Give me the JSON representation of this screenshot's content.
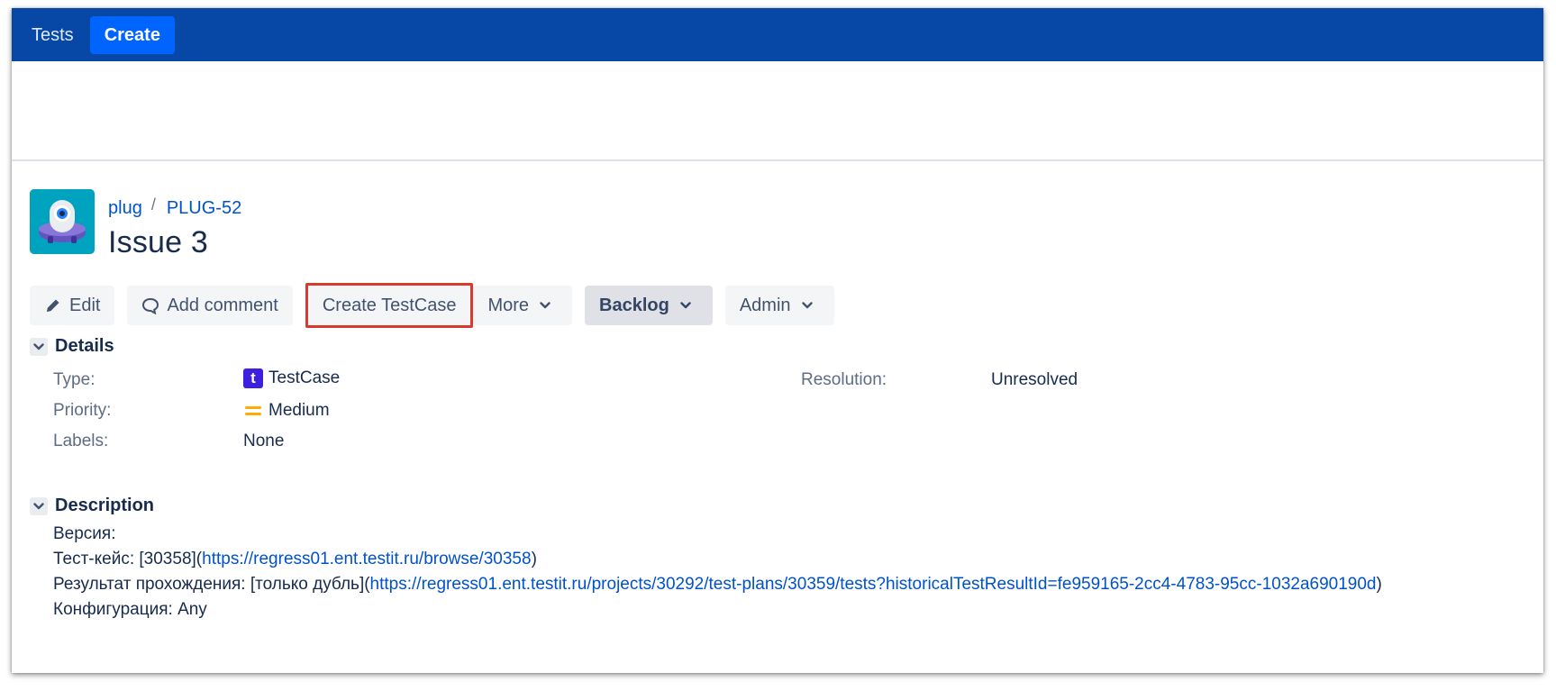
{
  "topnav": {
    "tests_label": "Tests",
    "create_label": "Create"
  },
  "breadcrumb": {
    "project": "plug",
    "separator": "/",
    "issue_key": "PLUG-52"
  },
  "issue": {
    "title": "Issue 3"
  },
  "toolbar": {
    "edit_label": "Edit",
    "comment_label": "Add comment",
    "create_testcase_label": "Create TestCase",
    "more_label": "More",
    "backlog_label": "Backlog",
    "admin_label": "Admin"
  },
  "details": {
    "heading": "Details",
    "type_label": "Type:",
    "type_value": "TestCase",
    "type_icon_letter": "t",
    "priority_label": "Priority:",
    "priority_value": "Medium",
    "labels_label": "Labels:",
    "labels_value": "None",
    "resolution_label": "Resolution:",
    "resolution_value": "Unresolved"
  },
  "description": {
    "heading": "Description",
    "line1": "Версия:",
    "line2_prefix": "Тест-кейс: [30358](",
    "line2_link": "https://regress01.ent.testit.ru/browse/30358",
    "line2_suffix": ")",
    "line3_prefix": "Результат прохождения: [только дубль](",
    "line3_link": "https://regress01.ent.testit.ru/projects/30292/test-plans/30359/tests?historicalTestResultId=fe959165-2cc4-4783-95cc-1032a690190d",
    "line3_suffix": ")",
    "line4": "Конфигурация: Any"
  },
  "colors": {
    "nav_bg": "#0747a6",
    "nav_create_bg": "#0065ff",
    "link": "#0052cc",
    "highlight_border": "#d73b2f",
    "type_icon": "#3d1fe0",
    "priority_medium": "#ffab00"
  },
  "icons": {
    "edit": "pencil-icon",
    "comment": "comment-icon",
    "chevron": "chevron-down-icon",
    "priority": "priority-medium-icon",
    "avatar": "project-avatar-icon"
  }
}
